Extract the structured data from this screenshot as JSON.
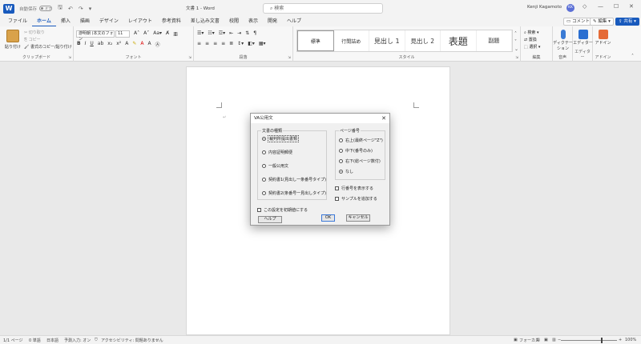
{
  "titlebar": {
    "app_icon": "W",
    "autosave_label": "自動保存",
    "autosave_state": "オフ",
    "doc_title": "文書 1 - Word",
    "search_placeholder": "検索",
    "user_name": "Kenji Kagamoto",
    "avatar_initials": "KK"
  },
  "tabs": [
    "ファイル",
    "ホーム",
    "挿入",
    "描画",
    "デザイン",
    "レイアウト",
    "参考資料",
    "差し込み文書",
    "校閲",
    "表示",
    "開発",
    "ヘルプ"
  ],
  "tab_buttons": {
    "comment": "コメント",
    "edit": "編集",
    "share": "共有"
  },
  "ribbon": {
    "clipboard": {
      "paste": "貼り付け",
      "cut": "切り取り",
      "copy": "コピー",
      "format_painter": "書式のコピー/貼り付け",
      "label": "クリップボード"
    },
    "font": {
      "name": "游明朝 (本文のフォン",
      "size": "11",
      "label": "フォント"
    },
    "paragraph": {
      "label": "段落"
    },
    "styles": {
      "items": [
        "標準",
        "行間詰め",
        "見出し 1",
        "見出し 2",
        "表題",
        "副題"
      ],
      "label": "スタイル"
    },
    "editing": {
      "find": "検索",
      "replace": "置換",
      "select": "選択",
      "label": "編集"
    },
    "voice": {
      "dictate": "ディクテーション",
      "label": "音声"
    },
    "editor": {
      "editor": "エディター",
      "label": "エディター"
    },
    "addins": {
      "addins": "アドイン",
      "label": "アドイン"
    }
  },
  "dialog": {
    "title": "VA公用文",
    "doc_type": {
      "legend": "文書の種類",
      "options": [
        "裁判所提出書類",
        "内容証明郵便",
        "一般公用文",
        "契約書1(見出し一条番号タイプ)",
        "契約書2(条番号一見出しタイプ)"
      ],
      "selected": 0
    },
    "page_number": {
      "legend": "ページ番号",
      "options": [
        "右上(最終ページ\"Z\")",
        "中下(番号のみ)",
        "右下(総ページ数付)",
        "なし"
      ],
      "selected": 3
    },
    "show_line_numbers": "行番号を表示する",
    "add_sample": "サンプルを追加する",
    "save_default": "この設定を初期値にする",
    "help": "ヘルプ",
    "ok": "OK",
    "cancel": "キャンセル"
  },
  "statusbar": {
    "page": "1/1 ページ",
    "words": "0 単語",
    "language": "日本語",
    "predict": "予測入力: オン",
    "accessibility": "アクセシビリティ: 問題ありません",
    "focus": "フォーカス",
    "zoom": "100%"
  }
}
